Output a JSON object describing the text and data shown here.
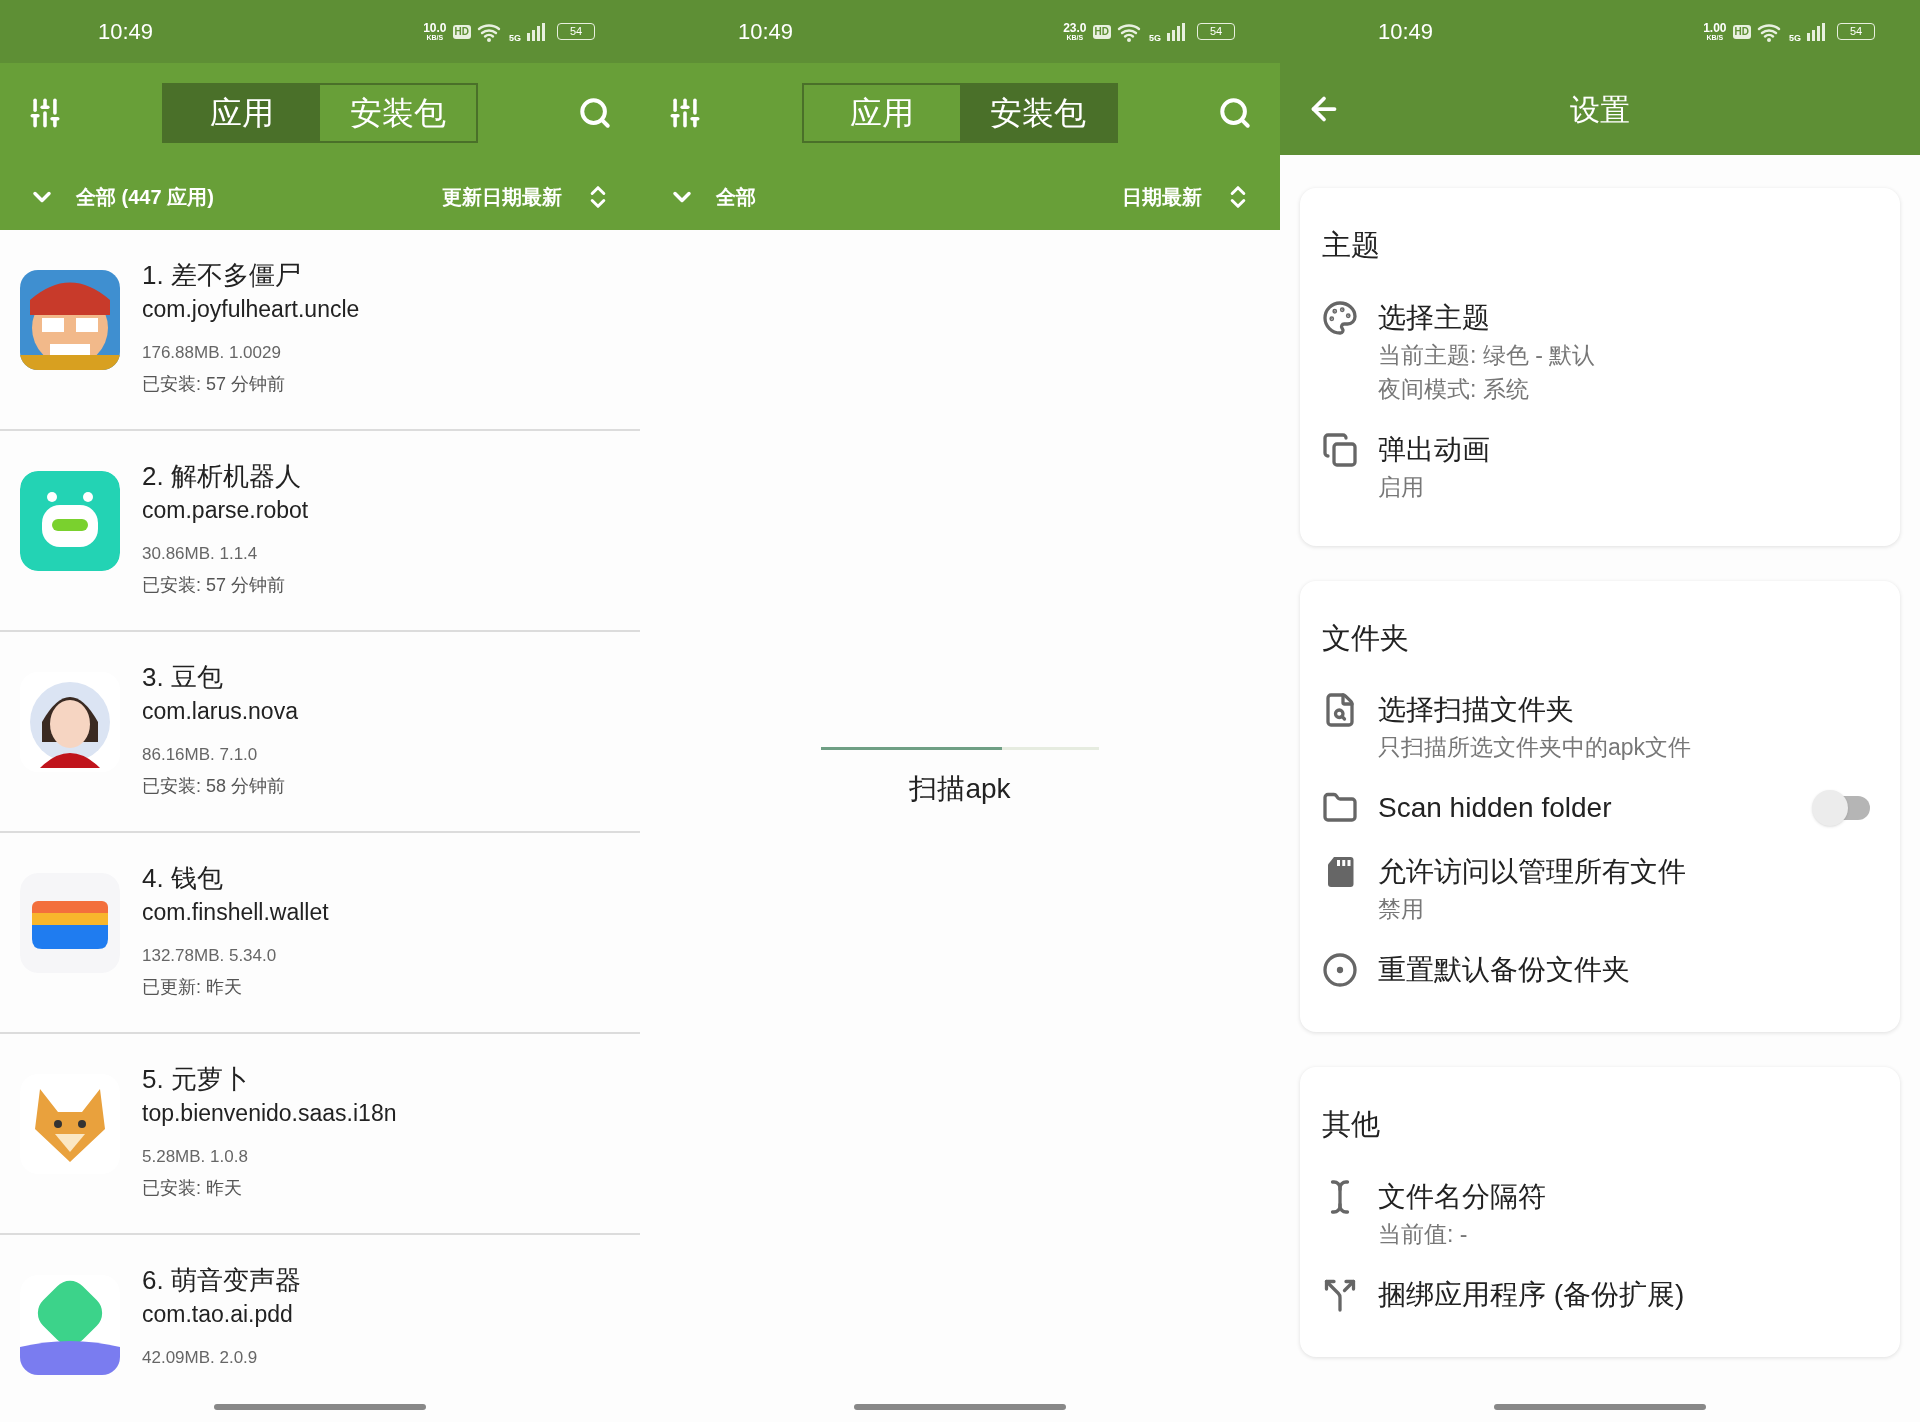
{
  "screens": [
    {
      "kind": "app_list",
      "status_bar": {
        "time": "10:49",
        "speed": "10.0",
        "speed_unit": "KB/S",
        "hd": "HD",
        "network": "5G",
        "battery": "54"
      },
      "tabs": [
        {
          "label": "应用",
          "selected": true
        },
        {
          "label": "安装包",
          "selected": false
        }
      ],
      "filter": {
        "label": "全部 (447 应用)"
      },
      "sort": {
        "label": "更新日期最新"
      },
      "apps": [
        {
          "title": "1. 差不多僵尸",
          "package": "com.joyfulheart.uncle",
          "meta": "176.88MB. 1.0029",
          "status": "已安装: 57 分钟前"
        },
        {
          "title": "2. 解析机器人",
          "package": "com.parse.robot",
          "meta": "30.86MB. 1.1.4",
          "status": "已安装: 57 分钟前"
        },
        {
          "title": "3. 豆包",
          "package": "com.larus.nova",
          "meta": "86.16MB. 7.1.0",
          "status": "已安装: 58 分钟前"
        },
        {
          "title": "4. 钱包",
          "package": "com.finshell.wallet",
          "meta": "132.78MB. 5.34.0",
          "status": "已更新: 昨天"
        },
        {
          "title": "5. 元萝卜",
          "package": "top.bienvenido.saas.i18n",
          "meta": "5.28MB. 1.0.8",
          "status": "已安装: 昨天"
        },
        {
          "title": "6. 萌音变声器",
          "package": "com.tao.ai.pdd",
          "meta": "42.09MB. 2.0.9"
        }
      ]
    },
    {
      "kind": "scanning",
      "status_bar": {
        "time": "10:49",
        "speed": "23.0",
        "speed_unit": "KB/S",
        "hd": "HD",
        "network": "5G",
        "battery": "54"
      },
      "tabs": [
        {
          "label": "应用",
          "selected": false
        },
        {
          "label": "安装包",
          "selected": true
        }
      ],
      "filter": {
        "label": "全部"
      },
      "sort": {
        "label": "日期最新"
      },
      "progress": {
        "level": 0.65
      },
      "message": "扫描apk"
    },
    {
      "kind": "settings",
      "status_bar": {
        "time": "10:49",
        "speed": "1.00",
        "speed_unit": "KB/S",
        "hd": "HD",
        "network": "5G",
        "battery": "54"
      },
      "title": "设置",
      "sections": [
        {
          "title": "主题",
          "items": [
            {
              "kind": "item",
              "title": "选择主题",
              "subtitles": [
                "当前主题: 绿色 - 默认",
                "夜间模式: 系统"
              ]
            },
            {
              "kind": "item",
              "title": "弹出动画",
              "subtitles": [
                "启用"
              ]
            }
          ]
        },
        {
          "title": "文件夹",
          "items": [
            {
              "kind": "item",
              "title": "选择扫描文件夹",
              "subtitles": [
                "只扫描所选文件夹中的apk文件"
              ]
            },
            {
              "kind": "switch",
              "title": "Scan hidden folder",
              "on": false
            },
            {
              "kind": "item",
              "title": "允许访问以管理所有文件",
              "subtitles": [
                "禁用"
              ]
            },
            {
              "kind": "item",
              "title": "重置默认备份文件夹"
            }
          ]
        },
        {
          "title": "其他",
          "items": [
            {
              "kind": "item",
              "title": "文件名分隔符",
              "subtitles": [
                "当前值: -"
              ]
            },
            {
              "kind": "item",
              "title": "捆绑应用程序 (备份扩展)"
            }
          ]
        }
      ]
    }
  ]
}
